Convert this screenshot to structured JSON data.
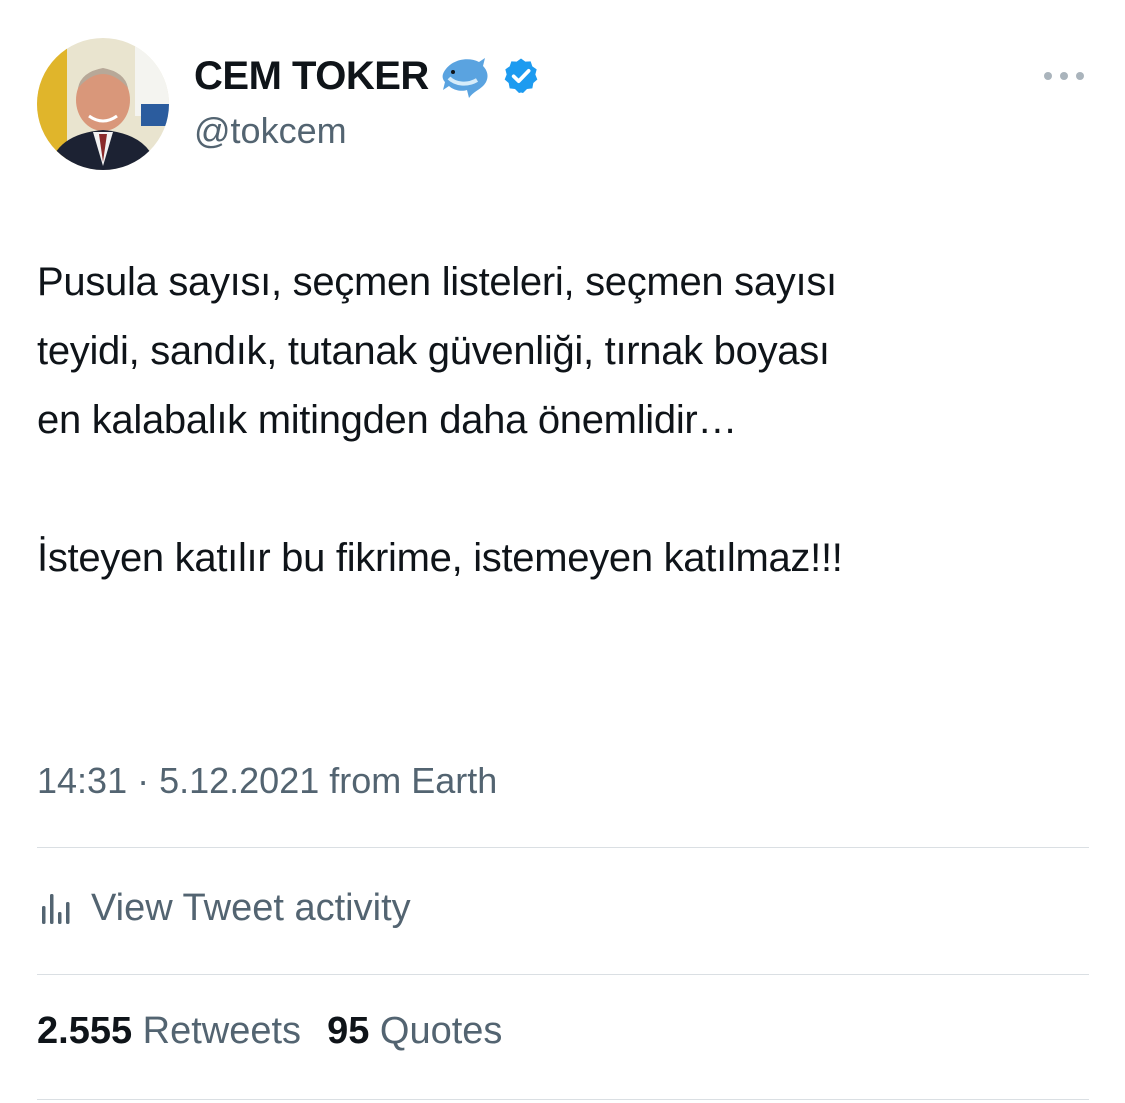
{
  "author": {
    "display_name": "CEM TOKER",
    "name_emoji": "dolphin-icon",
    "verified_badge": "verified-badge-icon",
    "handle": "@tokcem"
  },
  "tweet": {
    "lines": [
      "Pusula sayısı, seçmen listeleri, seçmen sayısı",
      "teyidi, sandık, tutanak güvenliği, tırnak boyası",
      "en kalabalık mitingden daha önemlidir…",
      "İsteyen katılır bu fikrime, istemeyen katılmaz!!!"
    ],
    "timestamp": "14:31 · 5.12.2021 from Earth"
  },
  "activity": {
    "icon": "bar-chart-icon",
    "label": "View Tweet activity"
  },
  "stats": {
    "retweets_count": "2.555",
    "retweets_label": "Retweets",
    "quotes_count": "95",
    "quotes_label": "Quotes"
  },
  "colors": {
    "text_primary": "#0f1419",
    "text_secondary": "#536471",
    "verified_blue": "#1d9bf0",
    "divider": "#dadfe3"
  }
}
